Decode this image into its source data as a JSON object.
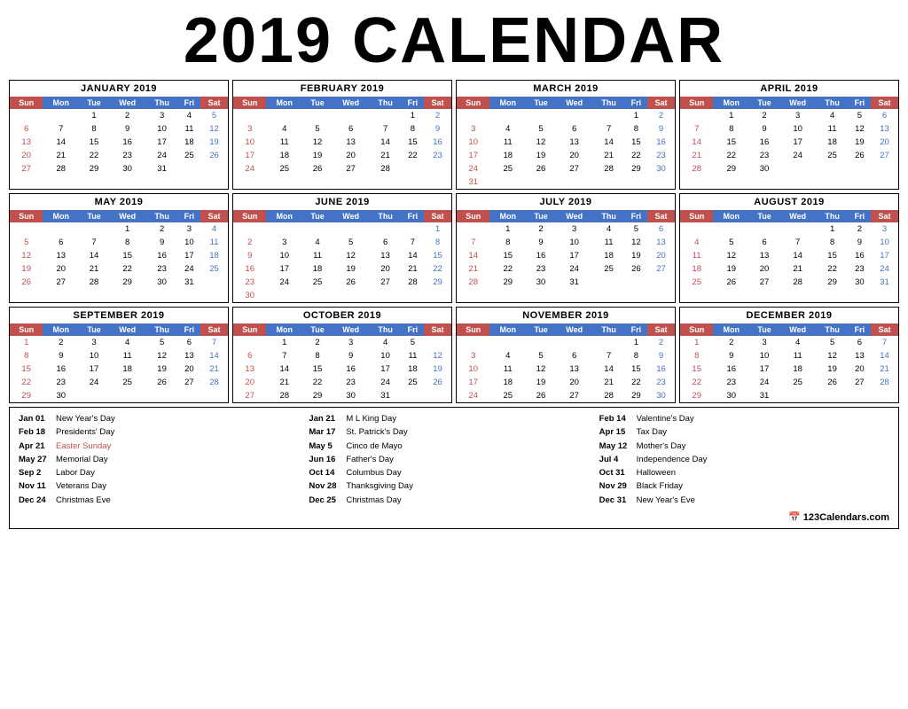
{
  "title": "2019 CALENDAR",
  "months": [
    {
      "name": "JANUARY 2019",
      "startDay": 2,
      "days": 31,
      "weeks": [
        [
          "",
          "",
          "1",
          "2",
          "3",
          "4",
          "5"
        ],
        [
          "6",
          "7",
          "8",
          "9",
          "10",
          "11",
          "12"
        ],
        [
          "13",
          "14",
          "15",
          "16",
          "17",
          "18",
          "19"
        ],
        [
          "20",
          "21",
          "22",
          "23",
          "24",
          "25",
          "26"
        ],
        [
          "27",
          "28",
          "29",
          "30",
          "31",
          "",
          ""
        ]
      ],
      "specials": {
        "1": "tue"
      }
    },
    {
      "name": "FEBRUARY 2019",
      "startDay": 5,
      "days": 28,
      "weeks": [
        [
          "",
          "",
          "",
          "",
          "",
          "1",
          "2"
        ],
        [
          "3",
          "4",
          "5",
          "6",
          "7",
          "8",
          "9"
        ],
        [
          "10",
          "11",
          "12",
          "13",
          "14",
          "15",
          "16"
        ],
        [
          "17",
          "18",
          "19",
          "20",
          "21",
          "22",
          "23"
        ],
        [
          "24",
          "25",
          "26",
          "27",
          "28",
          "",
          ""
        ]
      ]
    },
    {
      "name": "MARCH 2019",
      "startDay": 5,
      "days": 31,
      "weeks": [
        [
          "",
          "",
          "",
          "",
          "",
          "1",
          "2"
        ],
        [
          "3",
          "4",
          "5",
          "6",
          "7",
          "8",
          "9"
        ],
        [
          "10",
          "11",
          "12",
          "13",
          "14",
          "15",
          "16"
        ],
        [
          "17",
          "18",
          "19",
          "20",
          "21",
          "22",
          "23"
        ],
        [
          "24",
          "25",
          "26",
          "27",
          "28",
          "29",
          "30"
        ],
        [
          "31",
          "",
          "",
          "",
          "",
          "",
          ""
        ]
      ]
    },
    {
      "name": "APRIL 2019",
      "startDay": 1,
      "days": 30,
      "weeks": [
        [
          "",
          "1",
          "2",
          "3",
          "4",
          "5",
          "6"
        ],
        [
          "7",
          "8",
          "9",
          "10",
          "11",
          "12",
          "13"
        ],
        [
          "14",
          "15",
          "16",
          "17",
          "18",
          "19",
          "20"
        ],
        [
          "21",
          "22",
          "23",
          "24",
          "25",
          "26",
          "27"
        ],
        [
          "28",
          "29",
          "30",
          "",
          "",
          "",
          ""
        ]
      ]
    },
    {
      "name": "MAY 2019",
      "startDay": 3,
      "days": 31,
      "weeks": [
        [
          "",
          "",
          "",
          "1",
          "2",
          "3",
          "4"
        ],
        [
          "5",
          "6",
          "7",
          "8",
          "9",
          "10",
          "11"
        ],
        [
          "12",
          "13",
          "14",
          "15",
          "16",
          "17",
          "18"
        ],
        [
          "19",
          "20",
          "21",
          "22",
          "23",
          "24",
          "25"
        ],
        [
          "26",
          "27",
          "28",
          "29",
          "30",
          "31",
          ""
        ]
      ]
    },
    {
      "name": "JUNE 2019",
      "startDay": 6,
      "days": 30,
      "weeks": [
        [
          "",
          "",
          "",
          "",
          "",
          "",
          "1"
        ],
        [
          "2",
          "3",
          "4",
          "5",
          "6",
          "7",
          "8"
        ],
        [
          "9",
          "10",
          "11",
          "12",
          "13",
          "14",
          "15"
        ],
        [
          "16",
          "17",
          "18",
          "19",
          "20",
          "21",
          "22"
        ],
        [
          "23",
          "24",
          "25",
          "26",
          "27",
          "28",
          "29"
        ],
        [
          "30",
          "",
          "",
          "",
          "",
          "",
          ""
        ]
      ]
    },
    {
      "name": "JULY 2019",
      "startDay": 1,
      "days": 31,
      "weeks": [
        [
          "",
          "1",
          "2",
          "3",
          "4",
          "5",
          "6"
        ],
        [
          "7",
          "8",
          "9",
          "10",
          "11",
          "12",
          "13"
        ],
        [
          "14",
          "15",
          "16",
          "17",
          "18",
          "19",
          "20"
        ],
        [
          "21",
          "22",
          "23",
          "24",
          "25",
          "26",
          "27"
        ],
        [
          "28",
          "29",
          "30",
          "31",
          "",
          "",
          ""
        ]
      ]
    },
    {
      "name": "AUGUST 2019",
      "startDay": 4,
      "days": 31,
      "weeks": [
        [
          "",
          "",
          "",
          "",
          "1",
          "2",
          "3"
        ],
        [
          "4",
          "5",
          "6",
          "7",
          "8",
          "9",
          "10"
        ],
        [
          "11",
          "12",
          "13",
          "14",
          "15",
          "16",
          "17"
        ],
        [
          "18",
          "19",
          "20",
          "21",
          "22",
          "23",
          "24"
        ],
        [
          "25",
          "26",
          "27",
          "28",
          "29",
          "30",
          "31"
        ]
      ]
    },
    {
      "name": "SEPTEMBER 2019",
      "startDay": 0,
      "days": 30,
      "weeks": [
        [
          "1",
          "2",
          "3",
          "4",
          "5",
          "6",
          "7"
        ],
        [
          "8",
          "9",
          "10",
          "11",
          "12",
          "13",
          "14"
        ],
        [
          "15",
          "16",
          "17",
          "18",
          "19",
          "20",
          "21"
        ],
        [
          "22",
          "23",
          "24",
          "25",
          "26",
          "27",
          "28"
        ],
        [
          "29",
          "30",
          "",
          "",
          "",
          "",
          ""
        ]
      ]
    },
    {
      "name": "OCTOBER 2019",
      "startDay": 2,
      "days": 31,
      "weeks": [
        [
          "",
          "1",
          "2",
          "3",
          "4",
          "5",
          ""
        ],
        [
          "6",
          "7",
          "8",
          "9",
          "10",
          "11",
          "12"
        ],
        [
          "13",
          "14",
          "15",
          "16",
          "17",
          "18",
          "19"
        ],
        [
          "20",
          "21",
          "22",
          "23",
          "24",
          "25",
          "26"
        ],
        [
          "27",
          "28",
          "29",
          "30",
          "31",
          "",
          ""
        ]
      ]
    },
    {
      "name": "NOVEMBER 2019",
      "startDay": 5,
      "days": 30,
      "weeks": [
        [
          "",
          "",
          "",
          "",
          "",
          "1",
          "2"
        ],
        [
          "3",
          "4",
          "5",
          "6",
          "7",
          "8",
          "9"
        ],
        [
          "10",
          "11",
          "12",
          "13",
          "14",
          "15",
          "16"
        ],
        [
          "17",
          "18",
          "19",
          "20",
          "21",
          "22",
          "23"
        ],
        [
          "24",
          "25",
          "26",
          "27",
          "28",
          "29",
          "30"
        ]
      ]
    },
    {
      "name": "DECEMBER 2019",
      "startDay": 0,
      "days": 31,
      "weeks": [
        [
          "1",
          "2",
          "3",
          "4",
          "5",
          "6",
          "7"
        ],
        [
          "8",
          "9",
          "10",
          "11",
          "12",
          "13",
          "14"
        ],
        [
          "15",
          "16",
          "17",
          "18",
          "19",
          "20",
          "21"
        ],
        [
          "22",
          "23",
          "24",
          "25",
          "26",
          "27",
          "28"
        ],
        [
          "29",
          "30",
          "31",
          "",
          "",
          "",
          ""
        ]
      ]
    }
  ],
  "dayHeaders": [
    "Sun",
    "Mon",
    "Tue",
    "Wed",
    "Thu",
    "Fri",
    "Sat"
  ],
  "holidays": {
    "col1": [
      {
        "date": "Jan 01",
        "name": "New Year's Day"
      },
      {
        "date": "Feb 18",
        "name": "Presidents' Day"
      },
      {
        "date": "Apr 21",
        "name": "Easter Sunday",
        "red": true
      },
      {
        "date": "May 27",
        "name": "Memorial Day"
      },
      {
        "date": "Sep 2",
        "name": "Labor Day"
      },
      {
        "date": "Nov 11",
        "name": "Veterans Day"
      },
      {
        "date": "Dec 24",
        "name": "Christmas Eve"
      }
    ],
    "col2": [
      {
        "date": "Jan 21",
        "name": "M L King Day"
      },
      {
        "date": "Mar 17",
        "name": "St. Patrick's Day"
      },
      {
        "date": "May 5",
        "name": "Cinco de Mayo"
      },
      {
        "date": "Jun 16",
        "name": "Father's Day"
      },
      {
        "date": "Oct 14",
        "name": "Columbus Day"
      },
      {
        "date": "Nov 28",
        "name": "Thanksgiving Day"
      },
      {
        "date": "Dec 25",
        "name": "Christmas Day"
      }
    ],
    "col3": [
      {
        "date": "Feb 14",
        "name": "Valentine's Day"
      },
      {
        "date": "Apr 15",
        "name": "Tax Day"
      },
      {
        "date": "May 12",
        "name": "Mother's Day"
      },
      {
        "date": "Jul 4",
        "name": "Independence Day"
      },
      {
        "date": "Oct 31",
        "name": "Halloween"
      },
      {
        "date": "Nov 29",
        "name": "Black Friday"
      },
      {
        "date": "Dec 31",
        "name": "New Year's Eve"
      }
    ]
  },
  "logo": "123Calendars.com"
}
